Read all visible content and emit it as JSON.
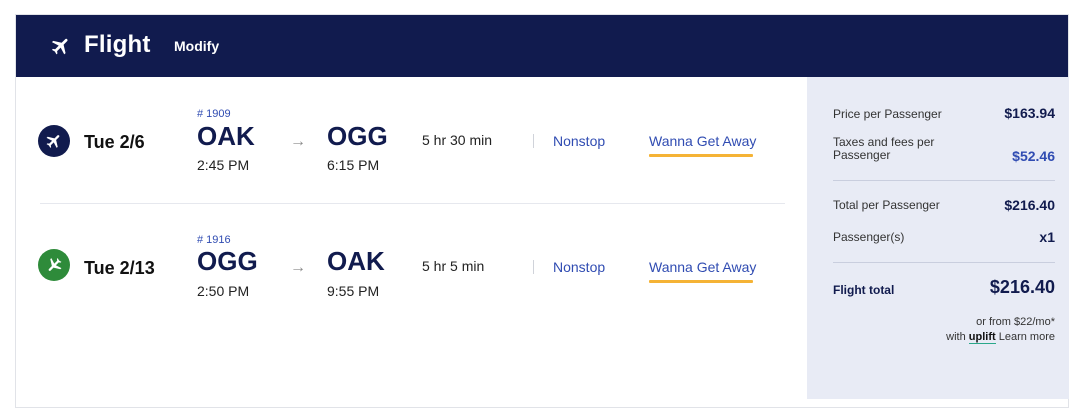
{
  "header": {
    "title": "Flight",
    "modify_label": "Modify"
  },
  "flights": [
    {
      "date": "Tue 2/6",
      "flight_number": "# 1909",
      "origin_code": "OAK",
      "depart_time": "2:45 PM",
      "dest_code": "OGG",
      "arrive_time": "6:15 PM",
      "duration": "5 hr 30 min",
      "stops": "Nonstop",
      "fare_class": "Wanna Get Away",
      "badge_color": "#111b4e"
    },
    {
      "date": "Tue 2/13",
      "flight_number": "# 1916",
      "origin_code": "OGG",
      "depart_time": "2:50 PM",
      "dest_code": "OAK",
      "arrive_time": "9:55 PM",
      "duration": "5 hr 5 min",
      "stops": "Nonstop",
      "fare_class": "Wanna Get Away",
      "badge_color": "#2e8b3a"
    }
  ],
  "summary": {
    "price_label": "Price per Passenger",
    "price_value": "$163.94",
    "taxes_label_1": "Taxes and fees per",
    "taxes_label_2": "Passenger",
    "taxes_value": "$52.46",
    "total_per_label": "Total per Passenger",
    "total_per_value": "$216.40",
    "passengers_label": "Passenger(s)",
    "passengers_value": "x1",
    "flight_total_label": "Flight total",
    "flight_total_value": "$216.40",
    "financing_line1": "or from $22/mo*",
    "financing_with": "with",
    "financing_brand": "uplift",
    "learn_more": "Learn more"
  },
  "colors": {
    "navy": "#111b4e",
    "link_blue": "#304cb2",
    "accent_yellow": "#f5b335",
    "summary_bg": "#e8ebf5"
  }
}
